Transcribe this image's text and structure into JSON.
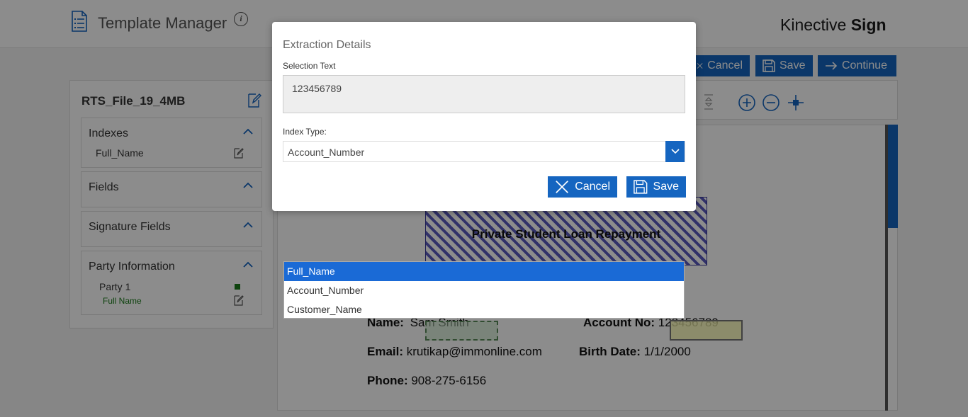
{
  "header": {
    "title": "Template Manager",
    "info_glyph": "i",
    "brand_light": "Kinective",
    "brand_bold": "Sign"
  },
  "toolbar": {
    "cancel_label": "Cancel",
    "save_label": "Save",
    "continue_label": "Continue"
  },
  "left_panel": {
    "file_name": "RTS_File_19_4MB",
    "sections": {
      "indexes": {
        "title": "Indexes",
        "items": [
          "Full_Name"
        ]
      },
      "fields": {
        "title": "Fields"
      },
      "signature_fields": {
        "title": "Signature Fields"
      },
      "party_information": {
        "title": "Party Information",
        "party": "Party 1",
        "party_color": "#1a7a1a",
        "party_field": "Full Name"
      }
    }
  },
  "document": {
    "heading": "Private Student Loan Repayment",
    "name_label": "Name:",
    "name_value": "Sam Smith",
    "account_label": "Account No:",
    "account_value": "123456789",
    "email_label": "Email:",
    "email_value": "krutikap@immonline.com",
    "birth_label": "Birth Date:",
    "birth_value": "1/1/2000",
    "phone_label": "Phone:",
    "phone_value": "908-275-6156"
  },
  "modal": {
    "title": "Extraction Details",
    "selection_label": "Selection Text",
    "selection_value": "123456789",
    "index_type_label": "Index Type:",
    "index_type_value": "Account_Number",
    "cancel_label": "Cancel",
    "save_label": "Save"
  },
  "dropdown": {
    "options": [
      "Full_Name",
      "Account_Number",
      "Customer_Name"
    ],
    "highlighted": "Full_Name"
  },
  "colors": {
    "accent": "#1565c0",
    "highlight": "#1a6ad6"
  }
}
